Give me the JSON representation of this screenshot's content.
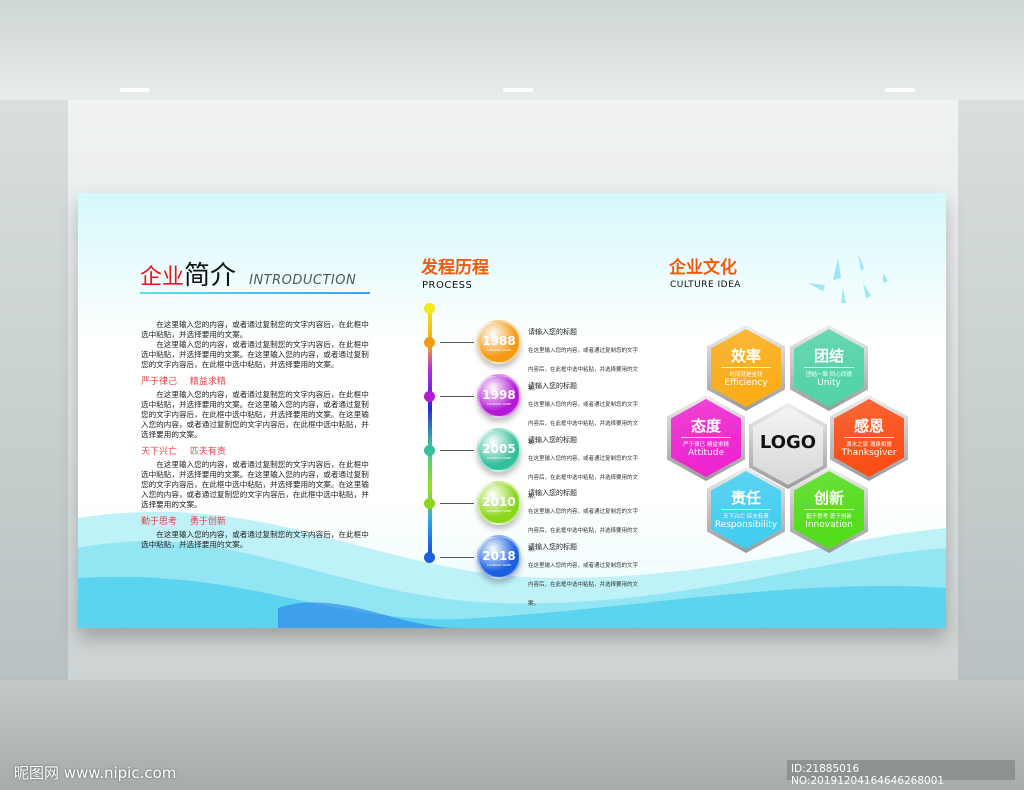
{
  "intro": {
    "title_red": "企业",
    "title_black": "简介",
    "title_en": "INTRODUCTION",
    "blocks": [
      {
        "sub": "",
        "paras": [
          "在这里输入您的内容，或者通过复制您的文字内容后，在此框中选中粘贴，并选择要用的文案。",
          "在这里输入您的内容，或者通过复制您的文字内容后，在此框中选中粘贴，并选择要用的文案。在这里输入您的内容，或者通过复制您的文字内容后，在此框中选中粘贴，并选择要用的文案。"
        ]
      },
      {
        "sub": "严于律己 精益求精",
        "paras": [
          "在这里输入您的内容，或者通过复制您的文字内容后，在此框中选中粘贴，并选择要用的文案。在这里输入您的内容，或者通过复制您的文字内容后，在此框中选中粘贴，并选择要用的文案。在这里输入您的内容，或者通过复制您的文字内容后，在此框中选中粘贴，并选择要用的文案。"
        ]
      },
      {
        "sub": "天下兴亡 匹夫有责",
        "paras": [
          "在这里输入您的内容，或者通过复制您的文字内容后，在此框中选中粘贴，并选择要用的文案。在这里输入您的内容，或者通过复制您的文字内容后，在此框中选中粘贴，并选择要用的文案。在这里输入您的内容，或者通过复制您的文字内容后，在此框中选中粘贴，并选择要用的文案。"
        ]
      },
      {
        "sub": "勤于思考 勇于创新",
        "paras": [
          "在这里输入您的内容，或者通过复制您的文字内容后，在此框中选中粘贴，并选择要用的文案。"
        ]
      }
    ]
  },
  "process": {
    "title": "发程历程",
    "title_en": "PROCESS",
    "events": [
      {
        "year": "1988",
        "company": "COMPANY NAME",
        "heading": "请输入您的标题",
        "text": "在这里输入您的内容，或者通过复制您的文字内容后，在此框中选中粘贴，并选择要用的文案。",
        "color": "#f39a16"
      },
      {
        "year": "1998",
        "company": "COMPANY NAME",
        "heading": "请输入您的标题",
        "text": "在这里输入您的内容，或者通过复制您的文字内容后，在此框中选中粘贴，并选择要用的文案。",
        "color": "#b21ad6"
      },
      {
        "year": "2005",
        "company": "COMPANY NAME",
        "heading": "请输入您的标题",
        "text": "在这里输入您的内容，或者通过复制您的文字内容后，在此框中选中粘贴，并选择要用的文案。",
        "color": "#35bf9c"
      },
      {
        "year": "2010",
        "company": "COMPANY NAME",
        "heading": "请输入您的标题",
        "text": "在这里输入您的内容，或者通过复制您的文字内容后，在此框中选中粘贴，并选择要用的文案。",
        "color": "#8ad61a"
      },
      {
        "year": "2018",
        "company": "COMPANY NAME",
        "heading": "请输入您的标题",
        "text": "在这里输入您的内容，或者通过复制您的文字内容后，在此框中选中粘贴，并选择要用的文案。",
        "color": "#1a5fe0"
      }
    ]
  },
  "culture": {
    "title": "企业文化",
    "title_en": "CULTURE   IDEA",
    "logo": "LOGO",
    "values": [
      {
        "cn": "效率",
        "sub": "时间就是金钱",
        "en": "Efficiency",
        "color": "#ffae12"
      },
      {
        "cn": "团结",
        "sub": "团结一致 同心同德",
        "en": "Unity",
        "color": "#4fd6a8"
      },
      {
        "cn": "态度",
        "sub": "严于律已 精益求精",
        "en": "Attitude",
        "color": "#f21fd2"
      },
      {
        "cn": "感恩",
        "sub": "滴水之恩 涌泉相报",
        "en": "Thanksgiver",
        "color": "#ff4a10"
      },
      {
        "cn": "责任",
        "sub": "天下兴亡 匹夫有责",
        "en": "Responsibility",
        "color": "#3fd0f5"
      },
      {
        "cn": "创新",
        "sub": "勤于思考 勇于创新",
        "en": "Innovation",
        "color": "#4fe014"
      }
    ]
  },
  "watermark": "昵图网 www.nipic.com",
  "image_id": "ID:21885016 NO:20191204164646268001"
}
